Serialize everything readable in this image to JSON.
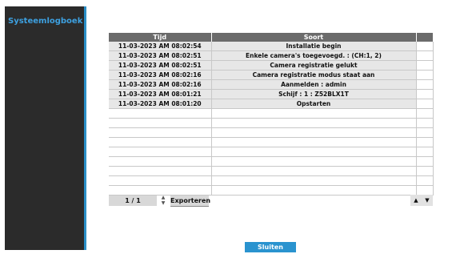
{
  "sidebar": {
    "title": "Systeemlogboek"
  },
  "table": {
    "headers": [
      "Tijd",
      "Soort"
    ],
    "rows": [
      {
        "time": "11-03-2023  AM 08:02:54",
        "type": "Installatie begin"
      },
      {
        "time": "11-03-2023  AM 08:02:51",
        "type": "Enkele camera's toegevoegd. : (CH:1, 2)"
      },
      {
        "time": "11-03-2023  AM 08:02:51",
        "type": "Camera registratie gelukt"
      },
      {
        "time": "11-03-2023  AM 08:02:16",
        "type": "Camera registratie modus staat aan"
      },
      {
        "time": "11-03-2023  AM 08:02:16",
        "type": "Aanmelden : admin"
      },
      {
        "time": "11-03-2023  AM 08:01:21",
        "type": "Schijf : 1 : Z52BLX1T"
      },
      {
        "time": "11-03-2023  AM 08:01:20",
        "type": "Opstarten"
      }
    ],
    "empty_rows": 9
  },
  "pagination": {
    "page": "1 / 1"
  },
  "buttons": {
    "export": "Exporteren",
    "close": "Sluiten"
  },
  "icons": {
    "spinner": "up-down-spinner-icon",
    "nav_up": "triangle-up-icon",
    "nav_down": "triangle-down-icon"
  },
  "colors": {
    "accent": "#2a93cf",
    "sidebar": "#2b2b2b",
    "header": "#6b6b6b"
  }
}
